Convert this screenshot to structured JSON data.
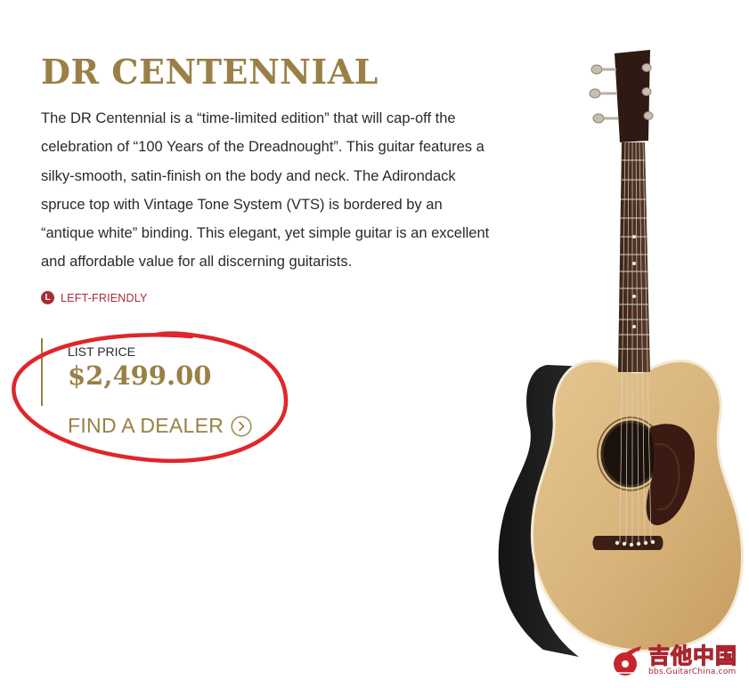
{
  "product": {
    "title": "DR CENTENNIAL",
    "description": "The DR Centennial is a “time-limited edition” that will cap-off the celebration of “100 Years of the Dreadnought”. This guitar features a silky-smooth, satin-finish on the body and neck. The Adirondack spruce top with Vintage Tone System (VTS) is bordered by an “antique white” binding. This elegant, yet simple guitar is an excellent and affordable value for all discerning guitarists.",
    "lefty_badge": "L",
    "lefty_label": "LEFT-FRIENDLY"
  },
  "pricing": {
    "label": "LIST PRICE",
    "value": "$2,499.00",
    "dealer_label": "FIND A DEALER",
    "dealer_icon": "chevron-right-circle-icon"
  },
  "watermark": {
    "chinese_text": "吉他中国",
    "url": "bbs.GuitarChina.com",
    "logo_icon": "guitarchina-logo"
  },
  "colors": {
    "gold": "#9a8046",
    "red": "#a92b37",
    "annotation_red": "#e0262b"
  }
}
